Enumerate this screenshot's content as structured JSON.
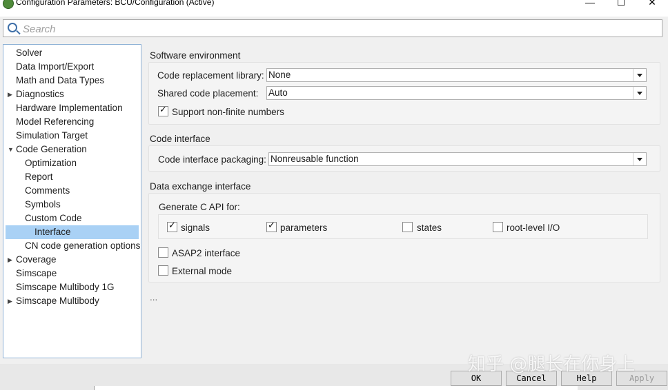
{
  "window": {
    "title": "Configuration Parameters: BCU/Configuration (Active)",
    "minimize_glyph": "—",
    "maximize_glyph": "☐",
    "close_glyph": "✕"
  },
  "search": {
    "placeholder": "Search",
    "value": ""
  },
  "tree": {
    "selected": "Interface",
    "items": [
      {
        "label": "Solver",
        "expander": ""
      },
      {
        "label": "Data Import/Export",
        "expander": ""
      },
      {
        "label": "Math and Data Types",
        "expander": ""
      },
      {
        "label": "Diagnostics",
        "expander": "▶"
      },
      {
        "label": "Hardware Implementation",
        "expander": ""
      },
      {
        "label": "Model Referencing",
        "expander": ""
      },
      {
        "label": "Simulation Target",
        "expander": ""
      },
      {
        "label": "Code Generation",
        "expander": "▼"
      },
      {
        "label": "Optimization",
        "expander": ""
      },
      {
        "label": "Report",
        "expander": ""
      },
      {
        "label": "Comments",
        "expander": ""
      },
      {
        "label": "Symbols",
        "expander": ""
      },
      {
        "label": "Custom Code",
        "expander": ""
      },
      {
        "label": "Interface",
        "expander": ""
      },
      {
        "label": "CN code generation options",
        "expander": ""
      },
      {
        "label": "Coverage",
        "expander": "▶"
      },
      {
        "label": "Simscape",
        "expander": ""
      },
      {
        "label": "Simscape Multibody 1G",
        "expander": ""
      },
      {
        "label": "Simscape Multibody",
        "expander": "▶"
      }
    ]
  },
  "software_env": {
    "title": "Software environment",
    "code_replacement_label": "Code replacement library:",
    "code_replacement_value": "None",
    "shared_code_label": "Shared code placement:",
    "shared_code_value": "Auto",
    "nonfinite_label": "Support non-finite numbers",
    "nonfinite_checked": true
  },
  "code_interface": {
    "title": "Code interface",
    "packaging_label": "Code interface packaging:",
    "packaging_value": "Nonreusable function"
  },
  "data_exchange": {
    "title": "Data exchange interface",
    "api_label": "Generate C API for:",
    "signals_label": "signals",
    "signals_checked": true,
    "parameters_label": "parameters",
    "parameters_checked": true,
    "states_label": "states",
    "states_checked": false,
    "rootio_label": "root-level I/O",
    "rootio_checked": false,
    "asap2_label": "ASAP2 interface",
    "asap2_checked": false,
    "external_label": "External mode",
    "external_checked": false
  },
  "ellipsis": "...",
  "buttons": {
    "ok": "OK",
    "cancel": "Cancel",
    "help": "Help",
    "apply": "Apply"
  },
  "watermark": "知乎 @腿长在你身上"
}
